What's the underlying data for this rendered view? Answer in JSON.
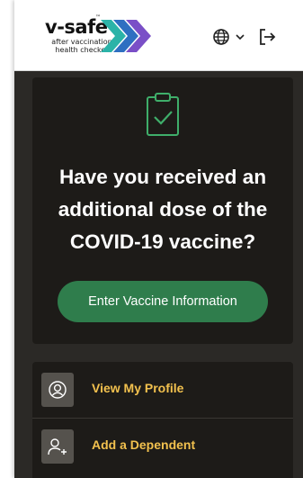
{
  "header": {
    "logo": {
      "wordmark": "v-safe",
      "trademark": "™",
      "tagline": "after vaccination health checker",
      "chevron_colors": [
        "#2bb3a8",
        "#2e6fc1",
        "#7a4fc7"
      ]
    },
    "language_icon": "globe-icon",
    "dropdown_icon": "chevron-down-icon",
    "logout_icon": "logout-icon"
  },
  "prompt_card": {
    "icon": "clipboard-check-icon",
    "question": "Have you received an additional dose of the COVID-19 vaccine?",
    "button_label": "Enter Vaccine Information",
    "button_color": "#2f7d4c",
    "accent_color": "#3fae6a"
  },
  "menu": {
    "items": [
      {
        "label": "View My Profile",
        "icon": "profile-icon"
      },
      {
        "label": "Add a Dependent",
        "icon": "add-person-icon"
      }
    ],
    "label_color": "#f2c14e"
  }
}
